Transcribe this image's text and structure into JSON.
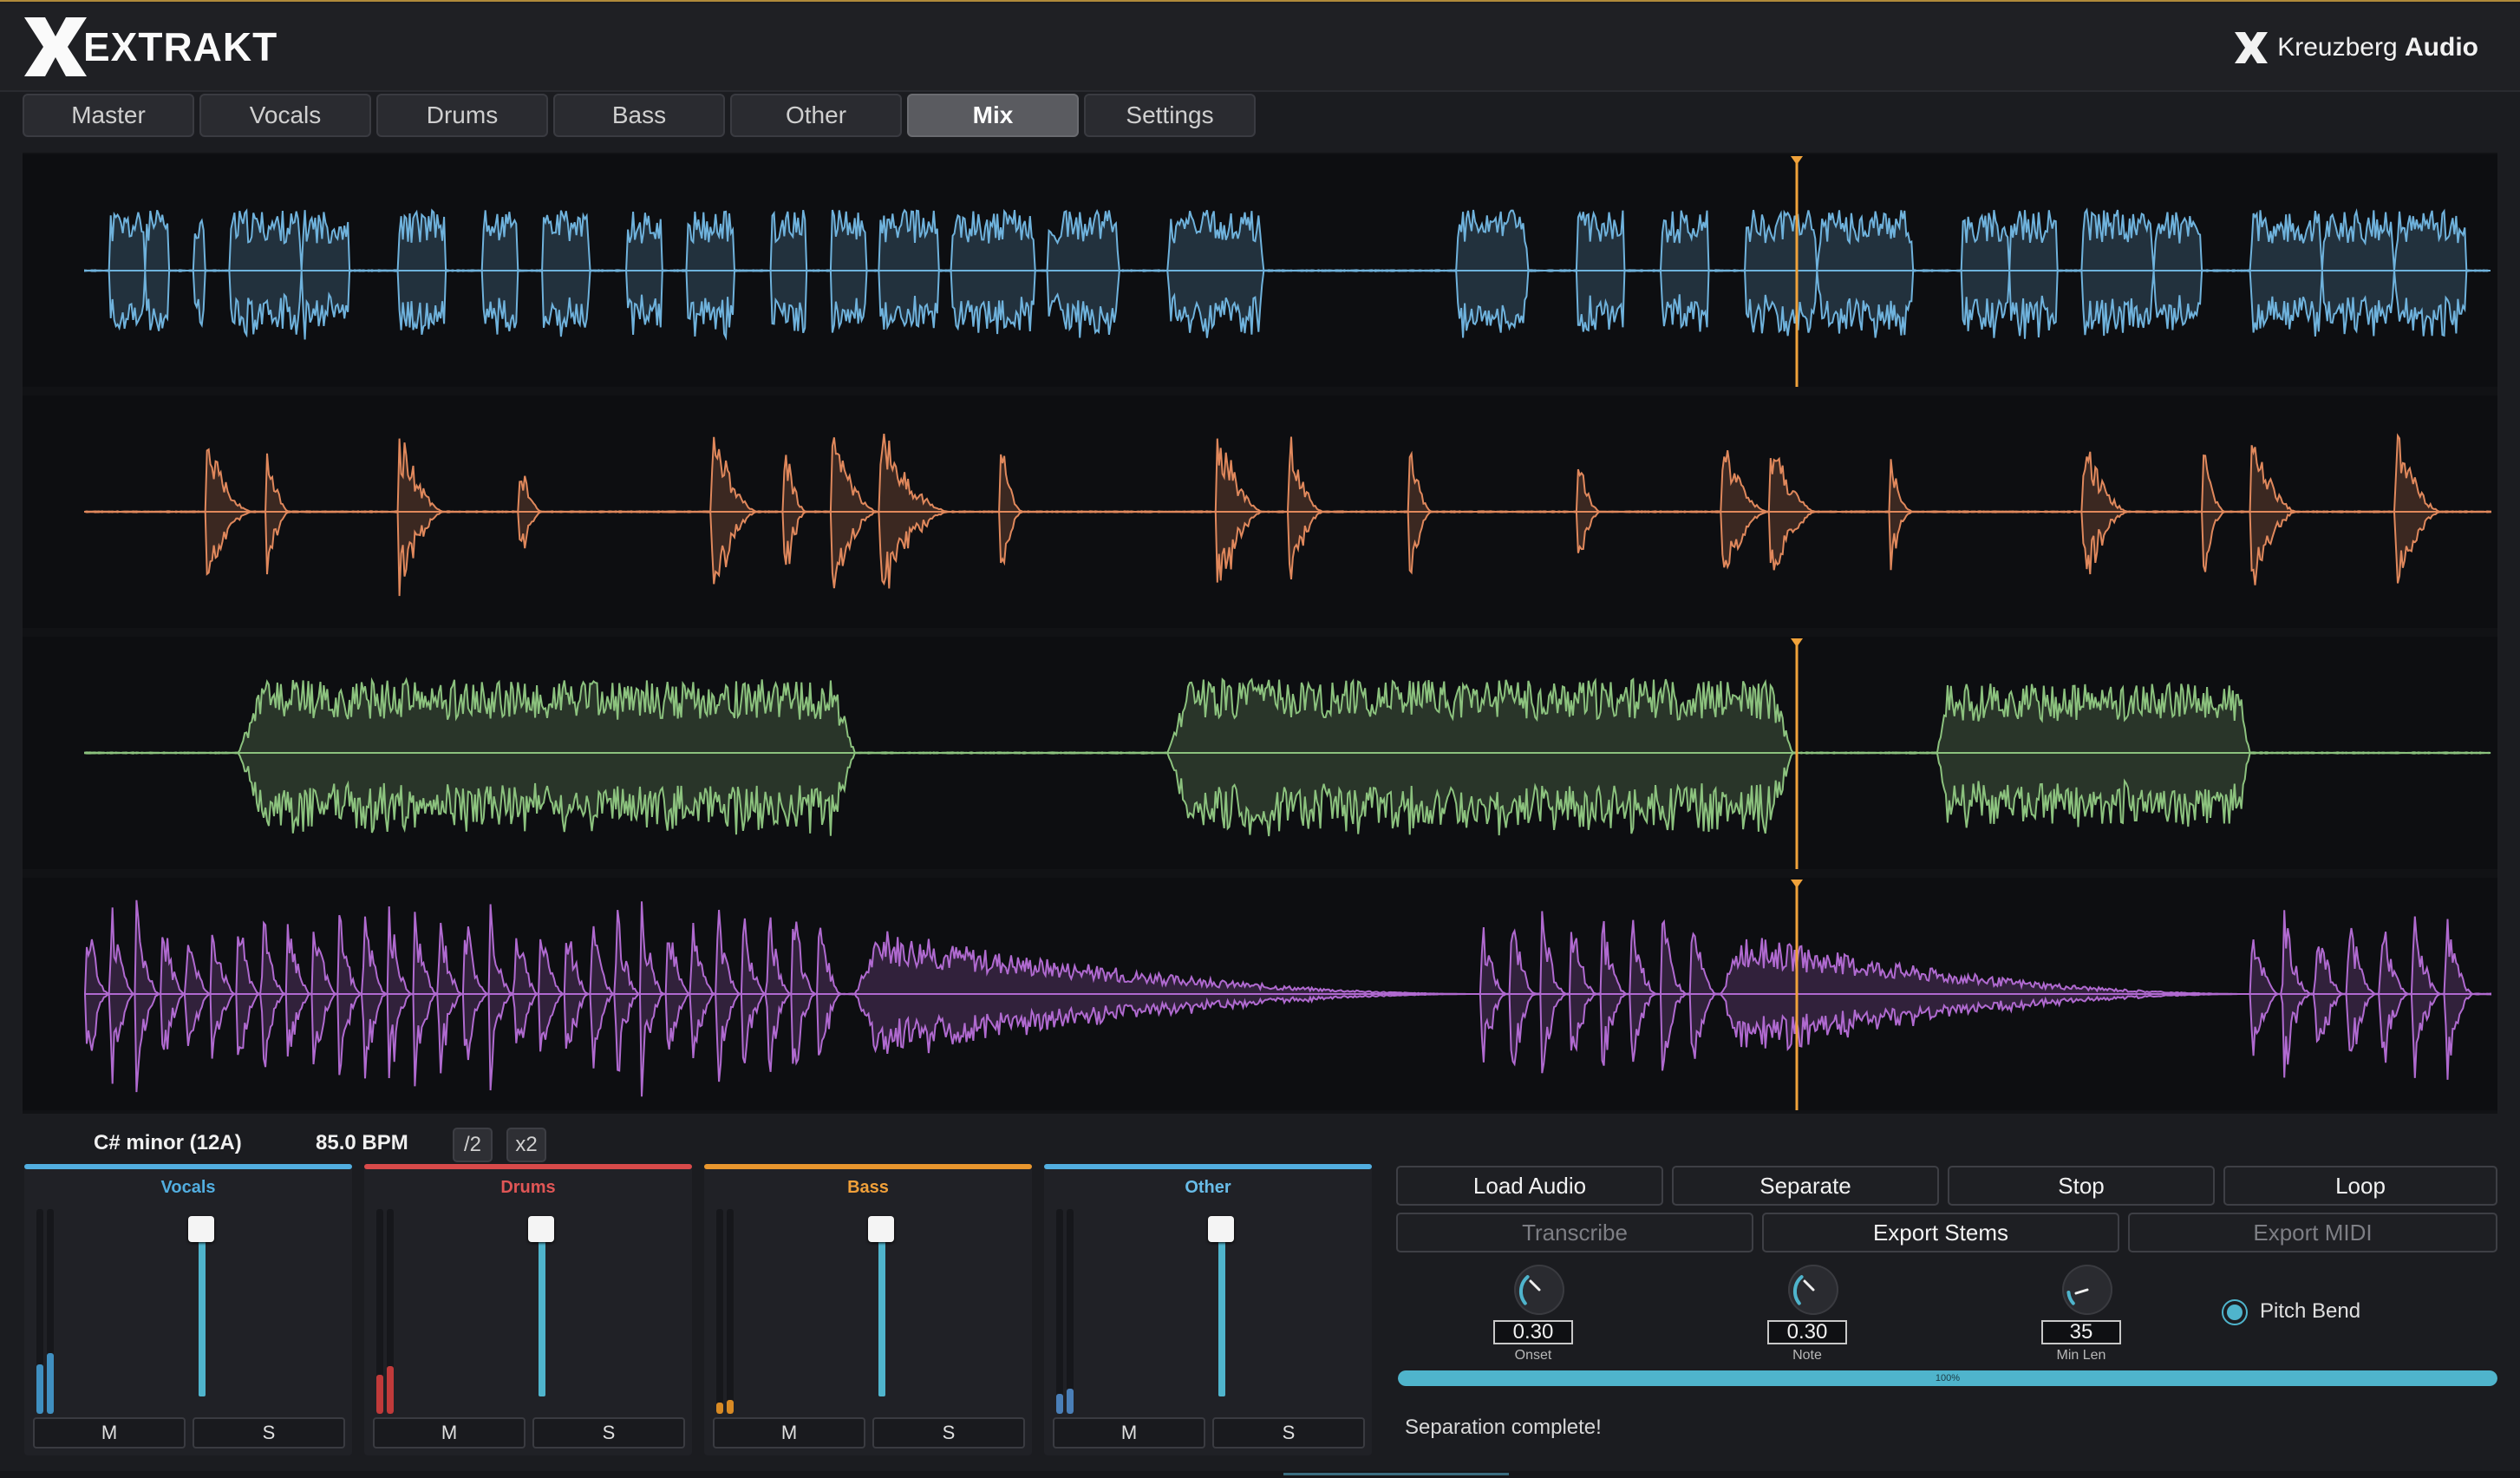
{
  "app": {
    "logo_text": "EXTRAKT",
    "brand_light": "Kreuzberg",
    "brand_bold": "Audio"
  },
  "tabs": [
    {
      "label": "Master",
      "active": false
    },
    {
      "label": "Vocals",
      "active": false
    },
    {
      "label": "Drums",
      "active": false
    },
    {
      "label": "Bass",
      "active": false
    },
    {
      "label": "Other",
      "active": false
    },
    {
      "label": "Mix",
      "active": true
    },
    {
      "label": "Settings",
      "active": false
    }
  ],
  "colors": {
    "vocals": "#6fb2dc",
    "drums": "#e0885c",
    "bass": "#8cc27e",
    "other": "#b06ad0",
    "playhead": "#f0a23a",
    "accent": "#4fb4cc"
  },
  "info": {
    "key": "C# minor (12A)",
    "bpm": "85.0 BPM",
    "half": "/2",
    "double": "x2"
  },
  "channels": [
    {
      "name": "Vocals",
      "bar_color": "#52aee0",
      "name_color": "#52aee0",
      "meter_color": "#3f8fc0",
      "level": 0.27,
      "mute": "M",
      "solo": "S"
    },
    {
      "name": "Drums",
      "bar_color": "#d84a4a",
      "name_color": "#e05656",
      "meter_color": "#c03a3a",
      "level": 0.21,
      "mute": "M",
      "solo": "S"
    },
    {
      "name": "Bass",
      "bar_color": "#e8962e",
      "name_color": "#f0a03a",
      "meter_color": "#d88a24",
      "level": 0.06,
      "mute": "M",
      "solo": "S"
    },
    {
      "name": "Other",
      "bar_color": "#52aee0",
      "name_color": "#68bce8",
      "meter_color": "#4a7fb8",
      "level": 0.11,
      "mute": "M",
      "solo": "S"
    }
  ],
  "buttons": {
    "load": "Load Audio",
    "separate": "Separate",
    "stop": "Stop",
    "loop": "Loop",
    "transcribe": "Transcribe",
    "export_stems": "Export Stems",
    "export_midi": "Export MIDI"
  },
  "knobs": [
    {
      "value": "0.30",
      "label": "Onset"
    },
    {
      "value": "0.30",
      "label": "Note"
    },
    {
      "value": "35",
      "label": "Min Len"
    }
  ],
  "pitch_bend": {
    "label": "Pitch Bend",
    "on": true
  },
  "progress": {
    "value": 100,
    "label": "100%"
  },
  "status": "Separation complete!"
}
